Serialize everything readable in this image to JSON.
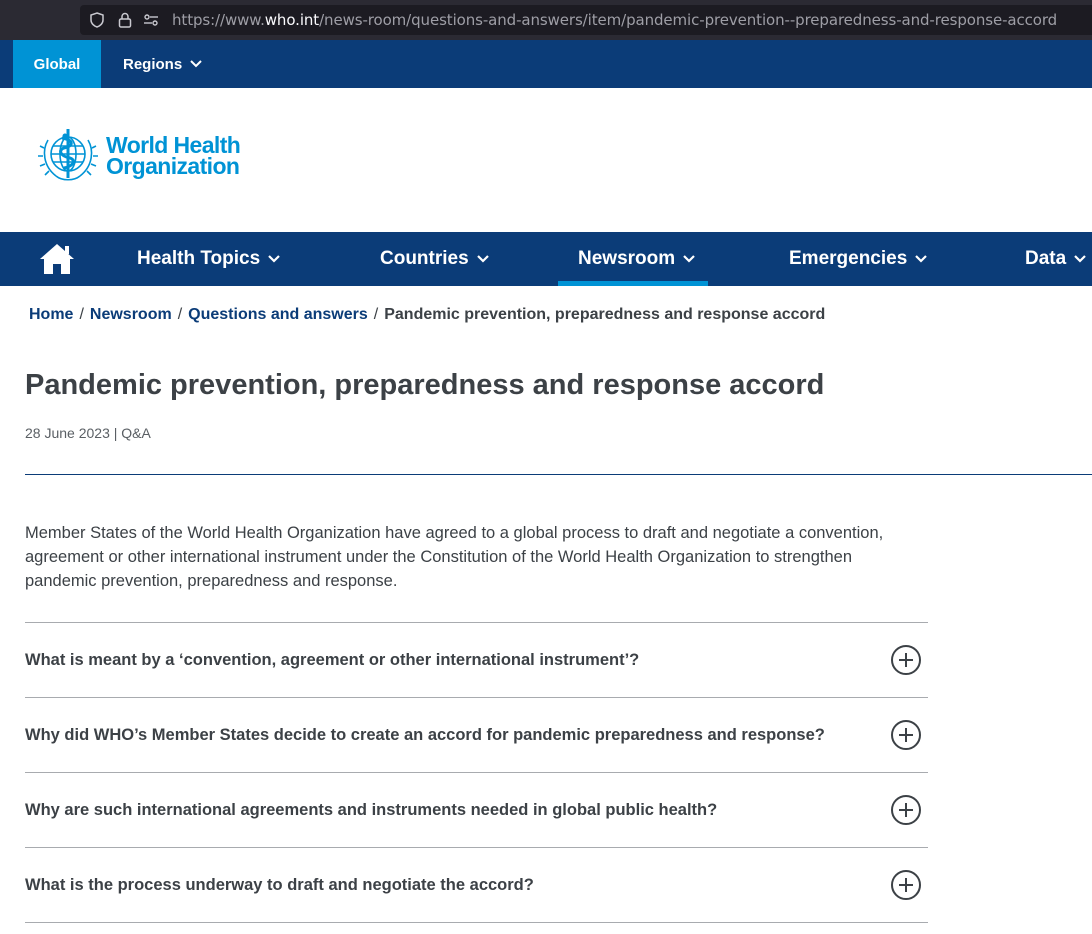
{
  "browser": {
    "url_prefix": "https://www.",
    "url_host": "who.int",
    "url_path": "/news-room/questions-and-answers/item/pandemic-prevention--preparedness-and-response-accord"
  },
  "region_bar": {
    "global_label": "Global",
    "regions_label": "Regions"
  },
  "logo": {
    "line1": "World Health",
    "line2": "Organization"
  },
  "nav": {
    "items": [
      {
        "label": "Health Topics"
      },
      {
        "label": "Countries"
      },
      {
        "label": "Newsroom"
      },
      {
        "label": "Emergencies"
      },
      {
        "label": "Data"
      }
    ]
  },
  "breadcrumb": {
    "items": [
      "Home",
      "Newsroom",
      "Questions and answers"
    ],
    "current": "Pandemic prevention, preparedness and response accord"
  },
  "page": {
    "title": "Pandemic prevention, preparedness and response accord",
    "meta": "28 June 2023 | Q&A",
    "intro": "Member States of the World Health Organization have agreed to a global process to draft and negotiate a convention, agreement or other international instrument under the Constitution of the World Health Organization to strengthen pandemic prevention, preparedness and response."
  },
  "faq": [
    {
      "question": "What is meant by a  ‘convention, agreement or other international instrument’?"
    },
    {
      "question": "Why did WHO’s Member States decide to create an accord for pandemic preparedness and response?"
    },
    {
      "question": "Why are such international agreements and instruments needed in global public health?"
    },
    {
      "question": "What is the process underway to draft and negotiate the accord?"
    }
  ],
  "colors": {
    "navy": "#0b3c78",
    "who_blue": "#0093d5",
    "text": "#3c4146"
  }
}
